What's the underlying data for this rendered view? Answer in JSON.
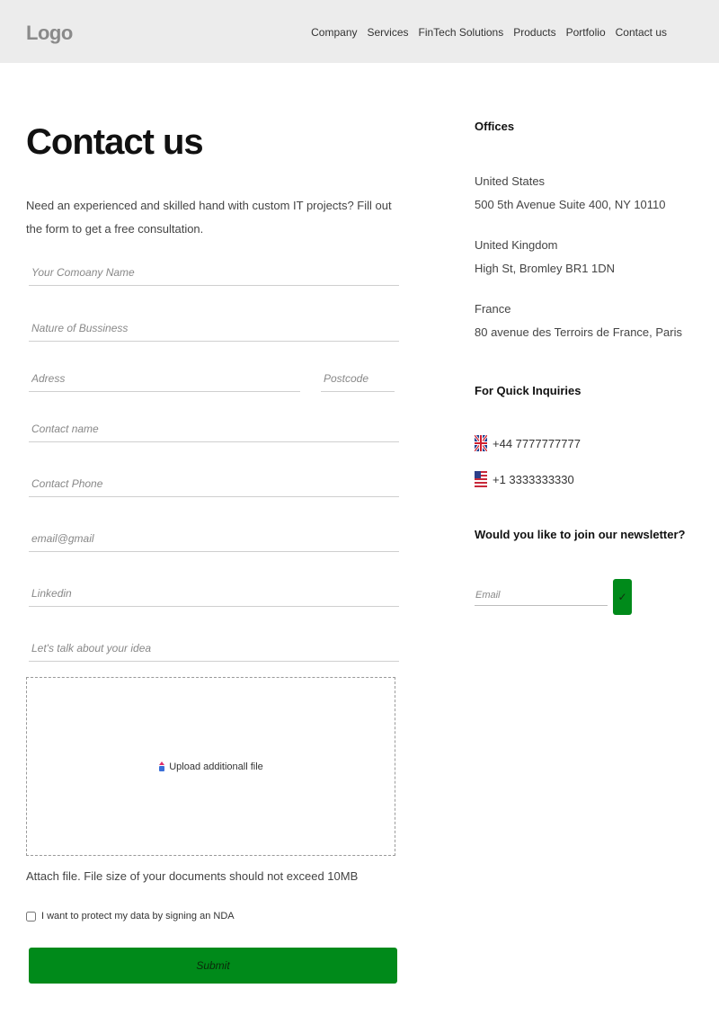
{
  "header": {
    "logo": "Logo",
    "nav": [
      "Company",
      "Services",
      "FinTech Solutions",
      "Products",
      "Portfolio",
      "Contact us"
    ]
  },
  "page": {
    "title": "Contact us",
    "intro": "Need an experienced and skilled hand with custom IT projects? Fill out the form to get a free consultation."
  },
  "form": {
    "company_placeholder": "Your Comoany Name",
    "business_placeholder": "Nature of Bussiness",
    "address_placeholder": "Adress",
    "postcode_placeholder": "Postcode",
    "contact_name_placeholder": "Contact name",
    "contact_phone_placeholder": "Contact Phone",
    "email_placeholder": "email@gmail",
    "linkedin_placeholder": "Linkedin",
    "idea_placeholder": "Let's talk about your idea",
    "upload_label": "Upload additionall file",
    "attach_note": "Attach file. File size of your documents should not exceed 10MB",
    "nda_label": "I want to protect my data by signing an NDA",
    "submit_label": "Submit"
  },
  "sidebar": {
    "offices_heading": "Offices",
    "offices": [
      {
        "country": "United States",
        "address": "500 5th Avenue Suite 400, NY 10110"
      },
      {
        "country": "United Kingdom",
        "address": "High St, Bromley BR1 1DN"
      },
      {
        "country": "France",
        "address": "80 avenue des Terroirs de France, Paris"
      }
    ],
    "inquiries_heading": "For Quick Inquiries",
    "phones": [
      {
        "flag": "uk-flag-icon",
        "number": "+44 7777777777"
      },
      {
        "flag": "us-flag-icon",
        "number": "+1 3333333330"
      }
    ],
    "newsletter_heading": "Would you like to join our newsletter?",
    "newsletter_placeholder": "Email",
    "newsletter_button": "✓"
  },
  "colors": {
    "accent": "#008a1a",
    "header_bg": "#ececec"
  }
}
